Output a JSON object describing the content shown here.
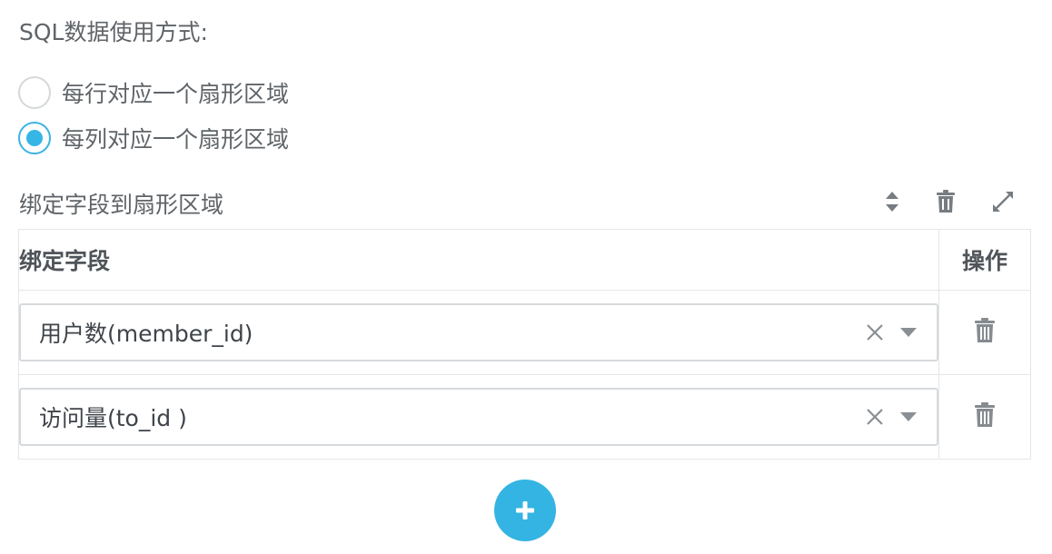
{
  "sql_mode": {
    "label": "SQL数据使用方式:",
    "options": [
      {
        "label": "每行对应一个扇形区域",
        "checked": false
      },
      {
        "label": "每列对应一个扇形区域",
        "checked": true
      }
    ]
  },
  "binding": {
    "title": "绑定字段到扇形区域",
    "toolbar_icons": [
      "sort-icon",
      "trash-icon",
      "expand-icon"
    ],
    "columns": {
      "field": "绑定字段",
      "actions": "操作"
    },
    "rows": [
      {
        "value": "用户数(member_id)"
      },
      {
        "value": "访问量(to_id )"
      }
    ],
    "add_icon": "plus-icon"
  },
  "colors": {
    "accent": "#35b6e5",
    "text": "#5f6468",
    "border": "#e4e6e8",
    "icon": "#888d92"
  }
}
